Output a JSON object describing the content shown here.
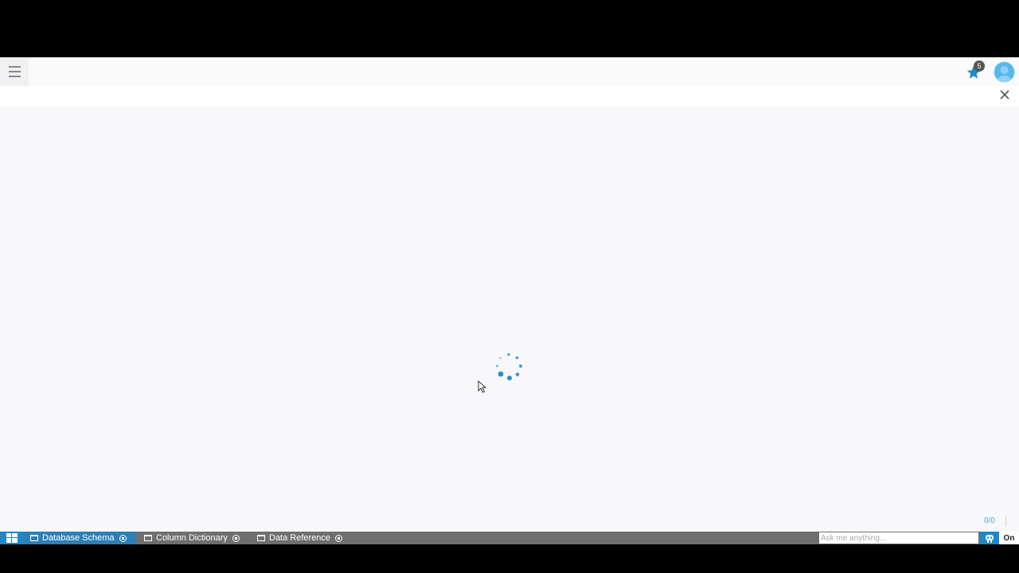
{
  "header": {
    "favorites_count": "5",
    "accent": "#1e88c8"
  },
  "pager": {
    "label": "0/0"
  },
  "taskbar": {
    "tabs": [
      {
        "label": "Database Schema",
        "active": true
      },
      {
        "label": "Column Dictionary",
        "active": false
      },
      {
        "label": "Data Reference",
        "active": false
      }
    ],
    "search_placeholder": "Ask me anything...",
    "brand": "On"
  },
  "icons": {
    "menu": "hamburger-icon",
    "favorites": "star-icon",
    "avatar": "user-avatar",
    "close": "close-icon",
    "loading": "spinner-icon",
    "start": "windows-icon",
    "assistant": "robot-icon"
  }
}
